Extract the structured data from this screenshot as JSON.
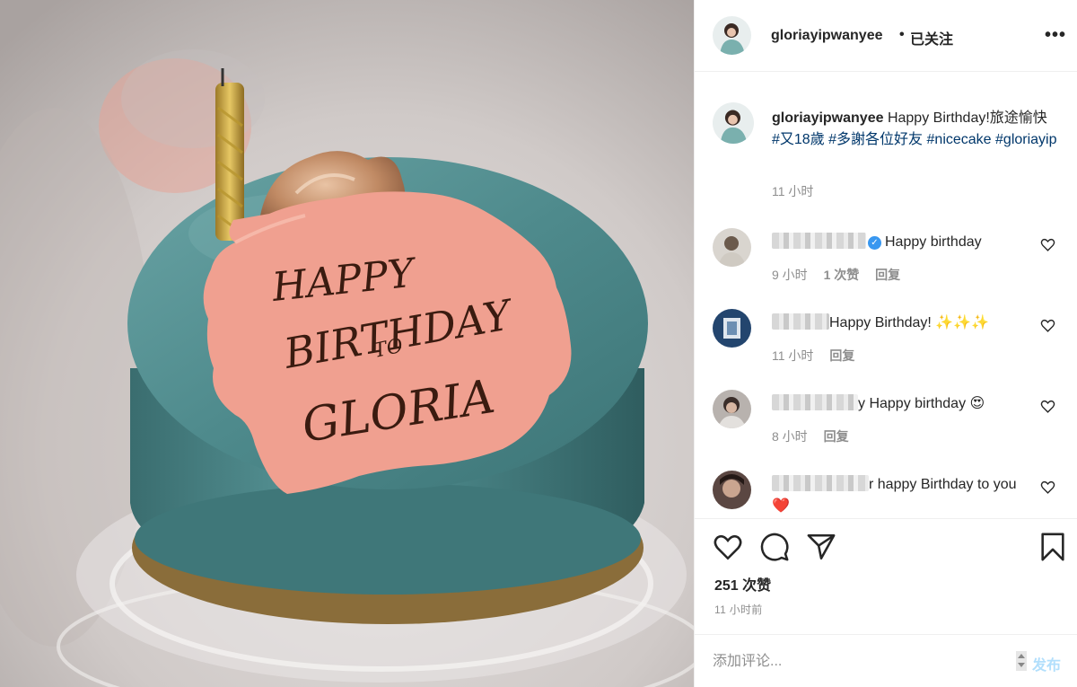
{
  "post": {
    "owner": "gloriayipwanyee",
    "separator": "•",
    "follow_status": "已关注",
    "more": "•••",
    "photo": {
      "cake_text_1": "HAPPY",
      "cake_text_2": "BIRTHDAY",
      "cake_text_3": "TO",
      "cake_text_4": "GLORIA"
    }
  },
  "caption": {
    "username": "gloriayipwanyee",
    "text": "Happy Birthday!旅途愉快",
    "tags": [
      "#又18歲",
      "#多謝各位好友",
      "#nicecake",
      "#gloriayip"
    ],
    "time": "11 小时"
  },
  "comments": [
    {
      "text": "Happy birthday",
      "time": "9 小时",
      "likes": "1 次赞",
      "reply": "回复",
      "verified": true
    },
    {
      "text": "Happy Birthday! ✨✨✨",
      "time": "11 小时",
      "reply": "回复"
    },
    {
      "text": "y Happy birthday 😍",
      "time": "8 小时",
      "reply": "回复"
    },
    {
      "text": "r happy Birthday to you❤️"
    }
  ],
  "actions": {
    "likes": "251 次赞",
    "posted": "11 小时前"
  },
  "add_comment": {
    "placeholder": "添加评论...",
    "publish": "发布"
  },
  "colors": {
    "tag": "#00376b",
    "meta": "#8e8e8e",
    "publish_disabled": "#b2dffc",
    "cake_glaze": "#4f8c8e",
    "cake_plaque": "#f0a090"
  }
}
